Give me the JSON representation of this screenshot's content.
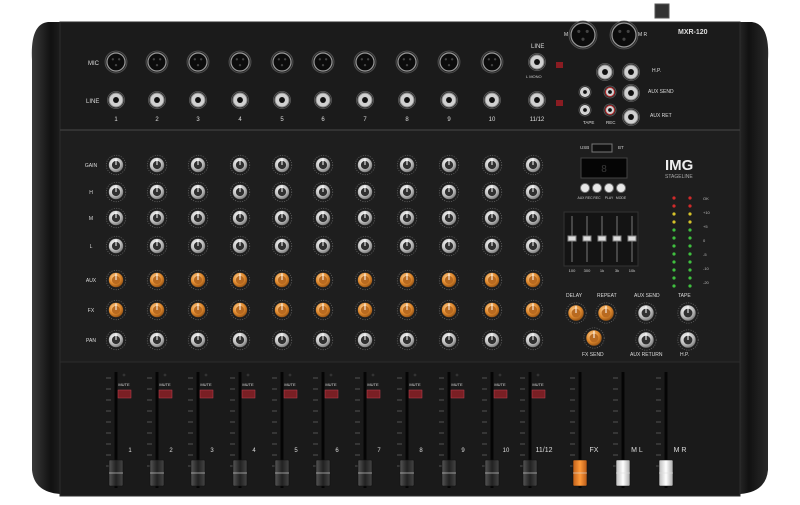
{
  "mixer": {
    "model": "MXR-120",
    "brand": "IMG",
    "brand_sub": "STAGELINE",
    "row_labels": [
      "MIC",
      "LINE"
    ],
    "knob_labels": [
      "GAIN",
      "H",
      "M",
      "L",
      "AUX",
      "FX",
      "PAN"
    ],
    "channels": [
      "1",
      "2",
      "3",
      "4",
      "5",
      "6",
      "7",
      "8",
      "9",
      "10",
      "11/12"
    ],
    "fader_channels": [
      "1",
      "2",
      "3",
      "4",
      "5",
      "6",
      "7",
      "8",
      "9",
      "10",
      "11/12",
      "FX",
      "M L",
      "M R"
    ],
    "line_label": "LINE",
    "io": {
      "ml": "M L",
      "mr": "M R",
      "hp": "H.P.",
      "aux_send": "AUX SEND",
      "aux_ret": "AUX RET",
      "tape": "TAPE",
      "rec": "REC",
      "l_mono": "L MONO",
      "usb": "USB",
      "bt": "BT"
    },
    "media_buttons": [
      "AUX REC",
      "REC",
      "PLAY",
      "MODE"
    ],
    "eq_bands": [
      "100",
      "300",
      "1k",
      "3k",
      "10k"
    ],
    "fx": {
      "delay": "DELAY",
      "repeat": "REPEAT",
      "fx_send": "FX SEND"
    },
    "aux": {
      "aux_send": "AUX SEND",
      "aux_return": "AUX RETURN"
    },
    "tape_out": {
      "tape": "TAPE",
      "hp": "H.P."
    },
    "meter_labels": [
      "OK",
      "+10",
      "+5",
      "0",
      "-5",
      "-10",
      "-20"
    ],
    "mute_label": "MUTE",
    "fader_scale": [
      "10",
      "5",
      "0dB",
      "5",
      "10",
      "20",
      "30",
      "40",
      "∞"
    ],
    "colors": {
      "body": "#1a1a1a",
      "panel": "#202020",
      "orange_knob": "#d9822b",
      "mute_red": "#7a1f24",
      "fx_fader": "#f07c1e",
      "meter_green": "#3fbf3f",
      "meter_red": "#d02a2a"
    }
  }
}
